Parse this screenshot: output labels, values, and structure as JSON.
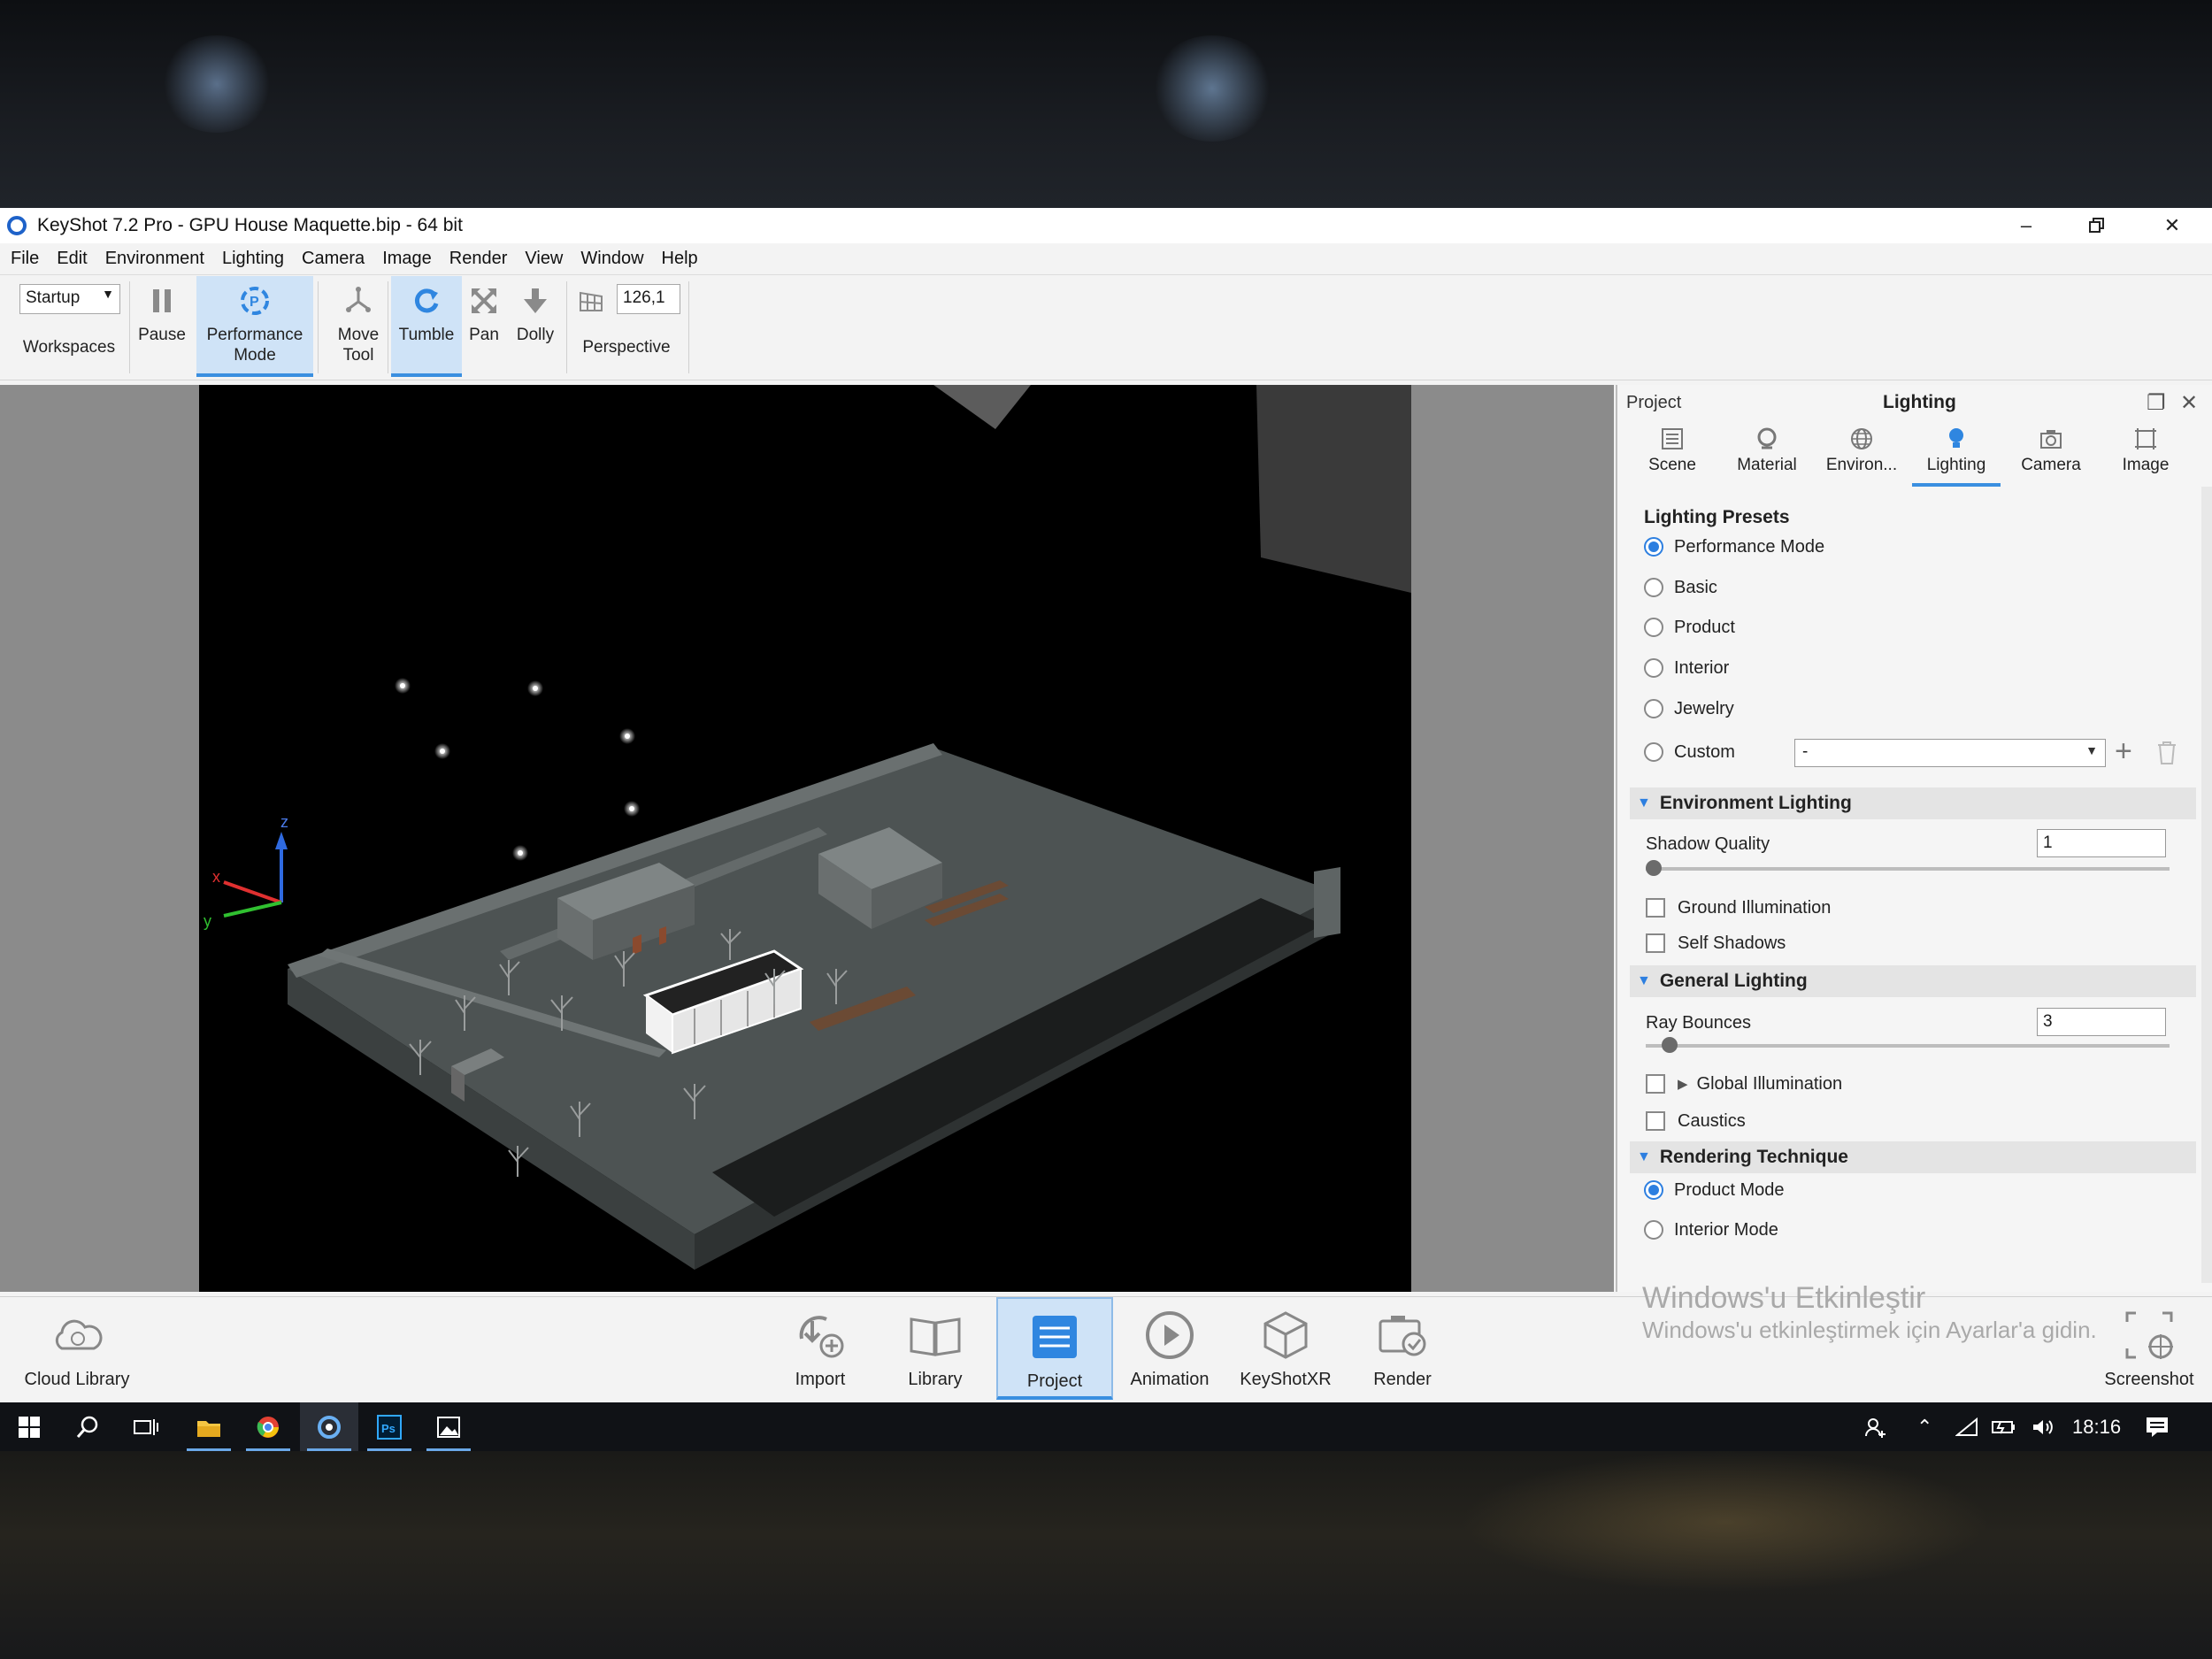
{
  "window": {
    "title": "KeyShot 7.2 Pro  - GPU House Maquette.bip  - 64 bit"
  },
  "menu": [
    "File",
    "Edit",
    "Environment",
    "Lighting",
    "Camera",
    "Image",
    "Render",
    "View",
    "Window",
    "Help"
  ],
  "toolbar": {
    "workspace_value": "Startup",
    "workspaces_label": "Workspaces",
    "pause_label": "Pause",
    "performance_label_1": "Performance",
    "performance_label_2": "Mode",
    "move_label_1": "Move",
    "move_label_2": "Tool",
    "tumble_label": "Tumble",
    "pan_label": "Pan",
    "dolly_label": "Dolly",
    "fov_value": "126,1",
    "perspective_label": "Perspective"
  },
  "viewport": {
    "axis_x": "x",
    "axis_y": "y",
    "axis_z": "z"
  },
  "panel": {
    "left_label": "Project",
    "title": "Lighting",
    "tabs": [
      "Scene",
      "Material",
      "Environ...",
      "Lighting",
      "Camera",
      "Image"
    ],
    "active_tab": "Lighting",
    "presets_title": "Lighting Presets",
    "presets": [
      "Performance Mode",
      "Basic",
      "Product",
      "Interior",
      "Jewelry",
      "Custom"
    ],
    "selected_preset": "Performance Mode",
    "custom_value": "-",
    "env_lighting": {
      "title": "Environment Lighting",
      "shadow_quality_label": "Shadow Quality",
      "shadow_quality_value": "1",
      "shadow_quality_level": 0,
      "ground_illumination": "Ground Illumination",
      "self_shadows": "Self Shadows"
    },
    "general_lighting": {
      "title": "General Lighting",
      "ray_bounces_label": "Ray Bounces",
      "ray_bounces_value": "3",
      "ray_bounces_level": 0.03,
      "global_illumination": "Global Illumination",
      "caustics": "Caustics"
    },
    "rendering_technique": {
      "title": "Rendering Technique",
      "options": [
        "Product Mode",
        "Interior Mode"
      ],
      "selected": "Product Mode"
    }
  },
  "bottombar": {
    "cloud_library": "Cloud Library",
    "import": "Import",
    "library": "Library",
    "project": "Project",
    "animation": "Animation",
    "keyshotxr": "KeyShotXR",
    "render": "Render",
    "screenshot": "Screenshot",
    "active": "Project"
  },
  "watermark": {
    "line1": "Windows'u Etkinleştir",
    "line2": "Windows'u etkinleştirmek için Ayarlar'a gidin."
  },
  "taskbar": {
    "time": "18:16"
  },
  "colors": {
    "accent": "#3a8fe0",
    "active_bg": "#cfe3f7",
    "viewport_bg": "#000000",
    "taskbar": "#101216"
  }
}
